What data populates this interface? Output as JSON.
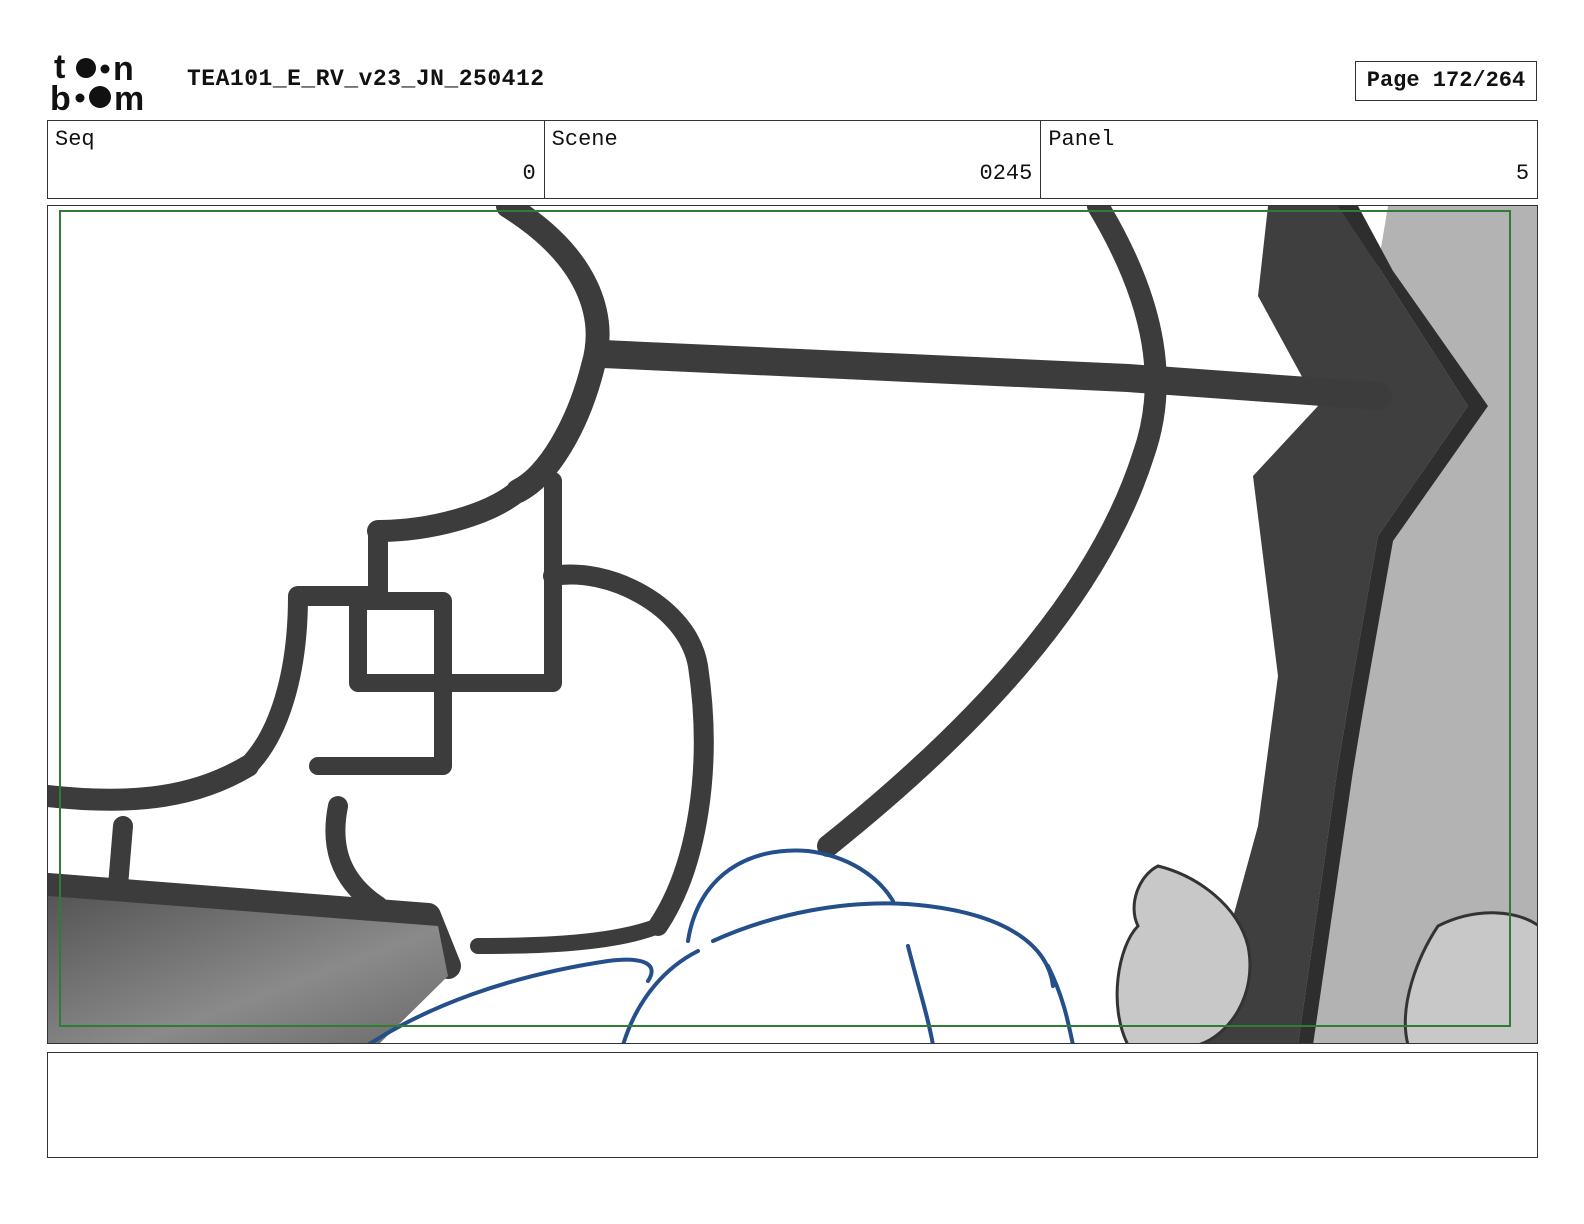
{
  "header": {
    "logo_text_top": "toon",
    "logo_text_bottom": "boom",
    "document_title": "TEA101_E_RV_v23_JN_250412",
    "page_indicator": "Page 172/264"
  },
  "info_row": {
    "seq_label": "Seq",
    "seq_value": "0",
    "scene_label": "Scene",
    "scene_value": "0245",
    "panel_label": "Panel",
    "panel_value": "5"
  },
  "panel_image": {
    "description_icon": "storyboard-sketch-window-lattice",
    "colors": {
      "frame_guide": "#2e7d32",
      "lattice": "#3c3c3c",
      "wall": "#b0b0b0",
      "character_line": "#244f8a"
    }
  },
  "notes": {
    "text": ""
  }
}
